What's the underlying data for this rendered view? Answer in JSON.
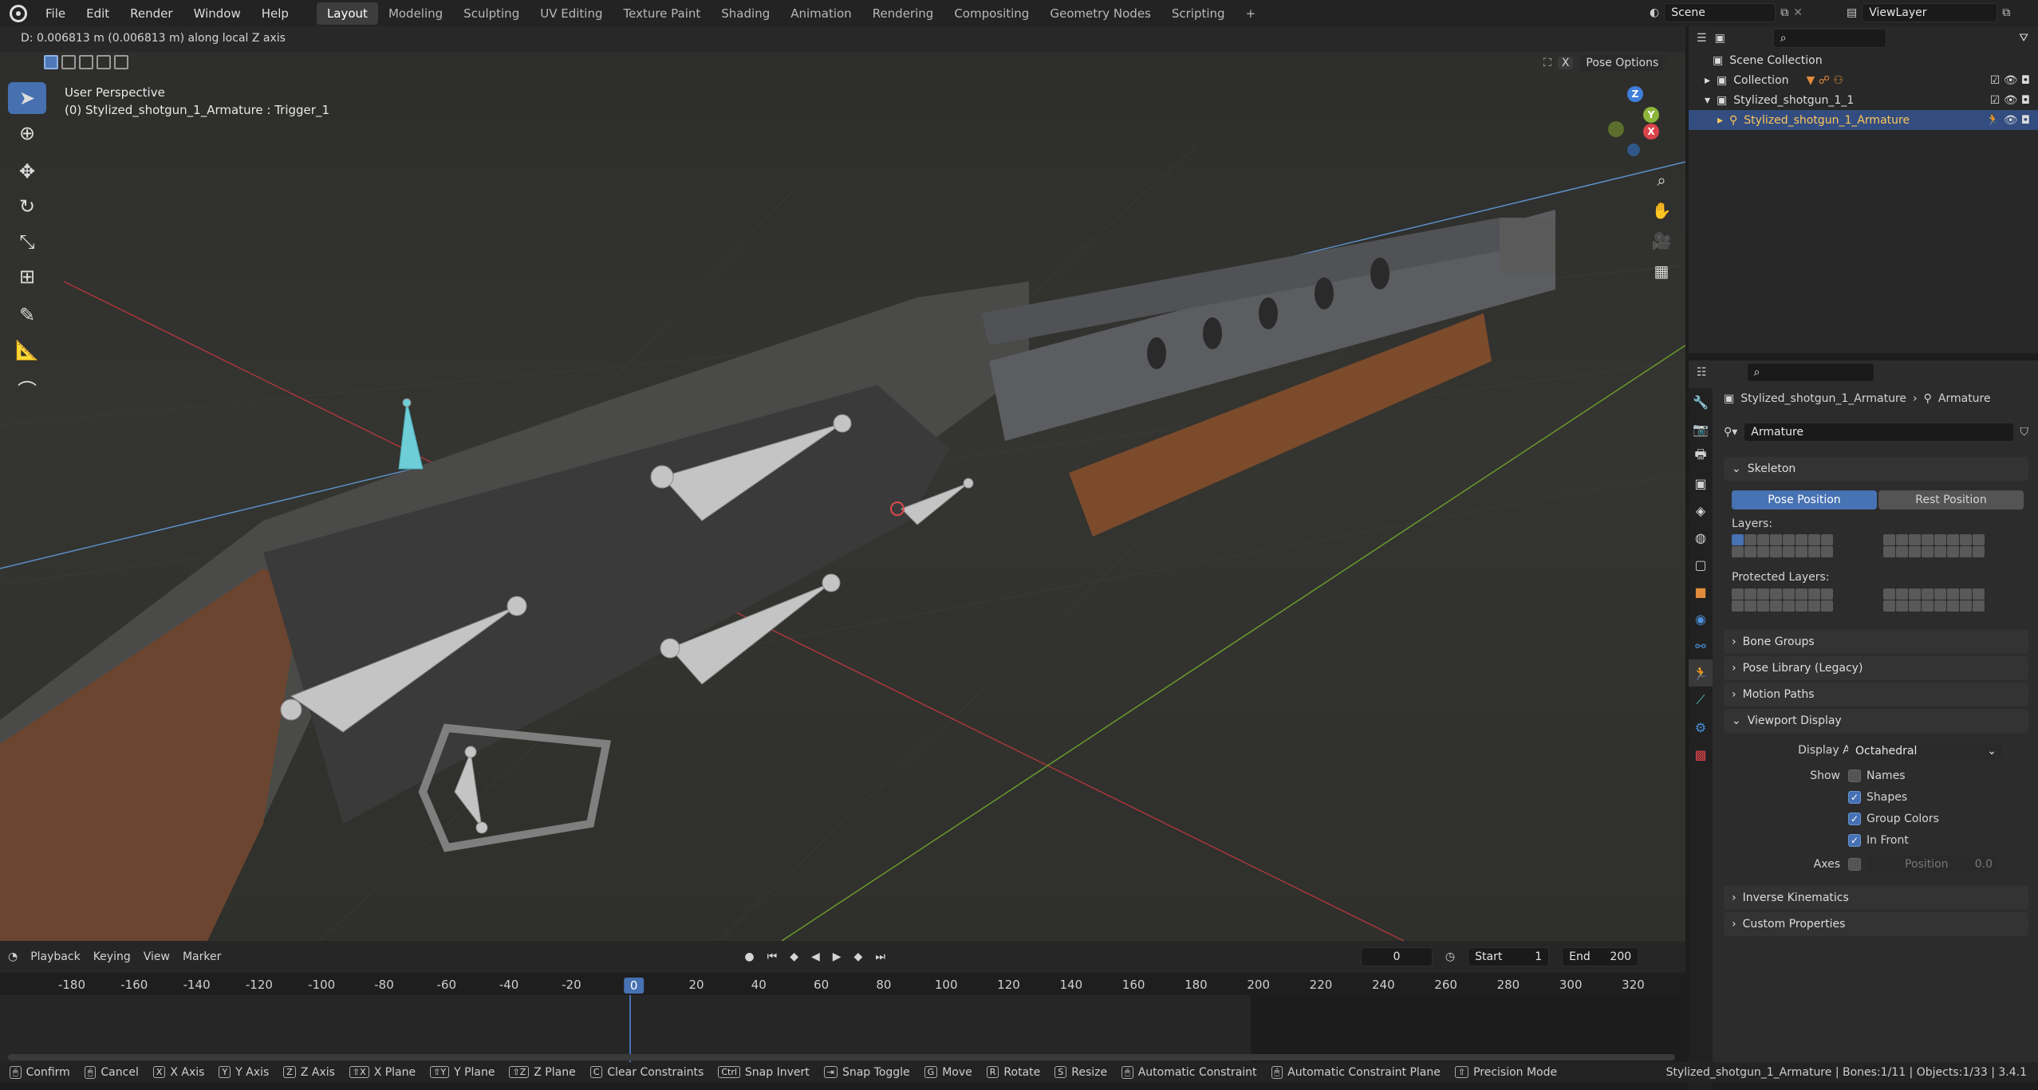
{
  "topbar": {
    "menus": [
      "File",
      "Edit",
      "Render",
      "Window",
      "Help"
    ],
    "workspaces": [
      "Layout",
      "Modeling",
      "Sculpting",
      "UV Editing",
      "Texture Paint",
      "Shading",
      "Animation",
      "Rendering",
      "Compositing",
      "Geometry Nodes",
      "Scripting",
      "+"
    ],
    "active_workspace": "Layout",
    "scene": "Scene",
    "view_layer": "ViewLayer"
  },
  "viewport": {
    "header_text": "D: 0.006813 m (0.006813 m) along local Z axis",
    "perspective": "User Perspective",
    "active": "(0) Stylized_shotgun_1_Armature : Trigger_1",
    "pose_options": "Pose Options",
    "x_label": "X",
    "gizmo": {
      "z": "Z",
      "y": "Y",
      "x": "X"
    }
  },
  "timeline": {
    "menus": [
      "Playback",
      "Keying",
      "View",
      "Marker"
    ],
    "current_frame": "0",
    "start_label": "Start",
    "start": "1",
    "end_label": "End",
    "end": "200",
    "ruler": [
      "-180",
      "-160",
      "-140",
      "-120",
      "-100",
      "-80",
      "-60",
      "-40",
      "-20",
      "0",
      "20",
      "40",
      "60",
      "80",
      "100",
      "120",
      "140",
      "160",
      "180",
      "200",
      "220",
      "240",
      "260",
      "280",
      "300",
      "320"
    ]
  },
  "outliner": {
    "rows": [
      {
        "label": "Scene Collection",
        "selected": false
      },
      {
        "label": "Collection",
        "selected": false
      },
      {
        "label": "Stylized_shotgun_1_1",
        "selected": false
      },
      {
        "label": "Stylized_shotgun_1_Armature",
        "selected": true
      }
    ]
  },
  "properties": {
    "breadcrumb_object": "Stylized_shotgun_1_Armature",
    "breadcrumb_data": "Armature",
    "data_name": "Armature",
    "skeleton": "Skeleton",
    "pose_position": "Pose Position",
    "rest_position": "Rest Position",
    "layers": "Layers:",
    "protected_layers": "Protected Layers:",
    "bone_groups": "Bone Groups",
    "pose_library": "Pose Library (Legacy)",
    "motion_paths": "Motion Paths",
    "viewport_display": "Viewport Display",
    "display_as_label": "Display As",
    "display_as": "Octahedral",
    "show_label": "Show",
    "names": "Names",
    "shapes": "Shapes",
    "group_colors": "Group Colors",
    "in_front": "In Front",
    "axes_label": "Axes",
    "position_label": "Position",
    "position_value": "0.0",
    "inverse_kinematics": "Inverse Kinematics",
    "custom_properties": "Custom Properties"
  },
  "statusbar": {
    "items": [
      {
        "key": "",
        "label": "Confirm"
      },
      {
        "key": "",
        "label": "Cancel"
      },
      {
        "key": "X",
        "label": "X Axis"
      },
      {
        "key": "Y",
        "label": "Y Axis"
      },
      {
        "key": "Z",
        "label": "Z Axis"
      },
      {
        "key": "⇧X",
        "label": "X Plane"
      },
      {
        "key": "⇧Y",
        "label": "Y Plane"
      },
      {
        "key": "⇧Z",
        "label": "Z Plane"
      },
      {
        "key": "C",
        "label": "Clear Constraints"
      },
      {
        "key": "Ctrl",
        "label": "Snap Invert"
      },
      {
        "key": "⇥",
        "label": "Snap Toggle"
      },
      {
        "key": "G",
        "label": "Move"
      },
      {
        "key": "R",
        "label": "Rotate"
      },
      {
        "key": "S",
        "label": "Resize"
      },
      {
        "key": "",
        "label": "Automatic Constraint"
      },
      {
        "key": "",
        "label": "Automatic Constraint Plane"
      },
      {
        "key": "⇧",
        "label": "Precision Mode"
      }
    ],
    "info": "Stylized_shotgun_1_Armature | Bones:1/11 | Objects:1/33 | 3.4.1"
  },
  "colors": {
    "accent": "#4772b3",
    "x_axis": "#d9444a",
    "y_axis": "#8cb53a",
    "z_axis": "#3f7fd9",
    "selected_text": "#ffc55a"
  }
}
